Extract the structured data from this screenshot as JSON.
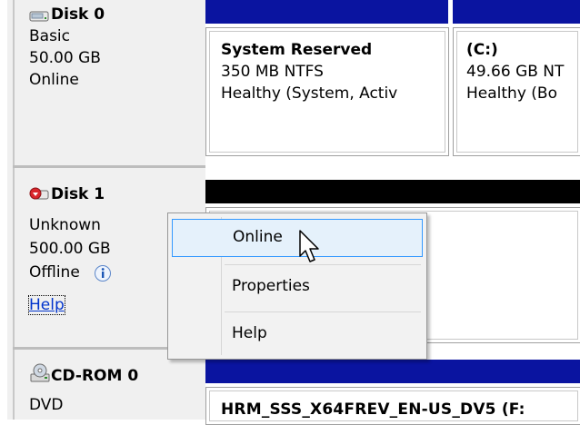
{
  "colors": {
    "primary_bar": "#0a14a0",
    "unallocated_bar": "#000000",
    "selection": "#e5f1fb",
    "selection_border": "#3399ff"
  },
  "disk0": {
    "name": "Disk 0",
    "type": "Basic",
    "size": "50.00 GB",
    "status": "Online",
    "partitions": [
      {
        "title": "System Reserved",
        "detail": "350 MB NTFS",
        "health": "Healthy (System, Activ"
      },
      {
        "title": "(C:)",
        "detail": "49.66 GB NT",
        "health": "Healthy (Bo"
      }
    ]
  },
  "disk1": {
    "name": "Disk 1",
    "type": "Unknown",
    "size": "500.00 GB",
    "status": "Offline",
    "help_link": "Help"
  },
  "cdrom0": {
    "name": "CD-ROM 0",
    "type": "DVD",
    "volume_label": "HRM_SSS_X64FREV_EN-US_DV5 (F:"
  },
  "context_menu": {
    "items": [
      {
        "label": "Online",
        "selected": true
      },
      {
        "label": "Properties",
        "selected": false
      },
      {
        "label": "Help",
        "selected": false
      }
    ]
  },
  "icons": [
    "disk-icon",
    "disk-offline-icon",
    "info-icon",
    "cdrom-icon",
    "mouse-cursor-icon"
  ]
}
